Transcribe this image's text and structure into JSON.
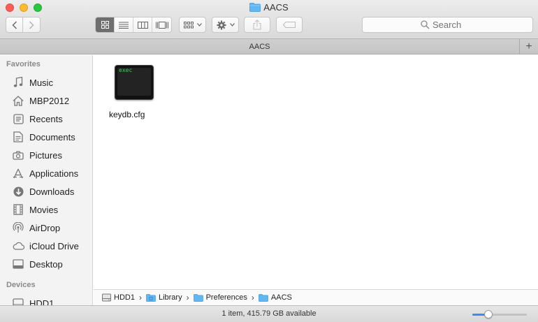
{
  "window": {
    "title": "AACS"
  },
  "toolbar": {
    "search_placeholder": "Search"
  },
  "tabbar": {
    "tab_label": "AACS",
    "add_label": "+"
  },
  "sidebar": {
    "favorites_heading": "Favorites",
    "favorites": [
      {
        "label": "Music",
        "icon": "music-icon"
      },
      {
        "label": "MBP2012",
        "icon": "home-icon"
      },
      {
        "label": "Recents",
        "icon": "recents-icon"
      },
      {
        "label": "Documents",
        "icon": "documents-icon"
      },
      {
        "label": "Pictures",
        "icon": "camera-icon"
      },
      {
        "label": "Applications",
        "icon": "applications-icon"
      },
      {
        "label": "Downloads",
        "icon": "download-icon"
      },
      {
        "label": "Movies",
        "icon": "film-icon"
      },
      {
        "label": "AirDrop",
        "icon": "airdrop-icon"
      },
      {
        "label": "iCloud Drive",
        "icon": "cloud-icon"
      },
      {
        "label": "Desktop",
        "icon": "desktop-icon"
      }
    ],
    "devices_heading": "Devices",
    "devices": [
      {
        "label": "HDD1",
        "icon": "disk-icon"
      }
    ]
  },
  "content": {
    "files": [
      {
        "name": "keydb.cfg",
        "icon_text": "exec",
        "icon": "exec-file-icon"
      }
    ]
  },
  "pathbar": {
    "crumbs": [
      {
        "label": "HDD1",
        "icon": "disk-icon"
      },
      {
        "label": "Library",
        "icon": "folder-icon"
      },
      {
        "label": "Preferences",
        "icon": "folder-icon"
      },
      {
        "label": "AACS",
        "icon": "folder-icon"
      }
    ]
  },
  "statusbar": {
    "text": "1 item, 415.79 GB available",
    "zoom_level": 0.25
  },
  "colors": {
    "folder_blue": "#5fb7f4",
    "accent": "#3b8cf5",
    "exec_green": "#3cd05a"
  }
}
